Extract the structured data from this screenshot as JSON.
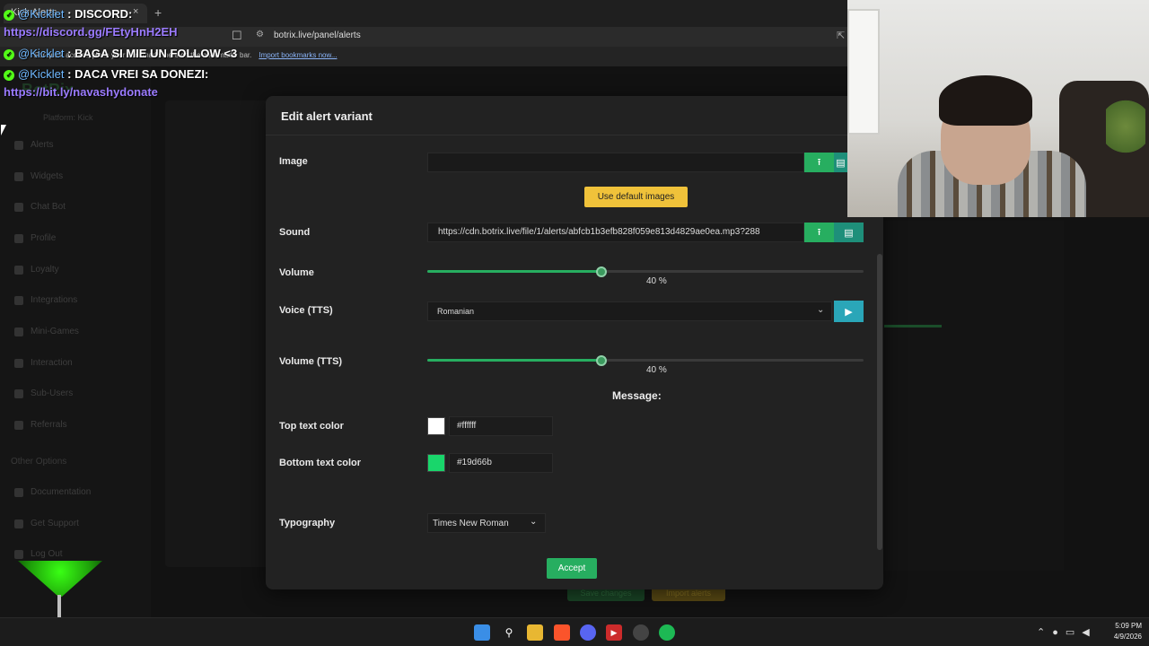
{
  "browser": {
    "tab_title": "Kick Alerts",
    "close_glyph": "×",
    "new_tab_glyph": "+",
    "url": "botrix.live/panel/alerts",
    "bookmark_bar_text": "For quick access, place your bookmarks here on the bookmarks bar.",
    "bookmark_bar_link": "Import bookmarks now..."
  },
  "chat": [
    {
      "user": "@Kicklet",
      "message": ": DISCORD:",
      "link": "https://discord.gg/FEtyHnH2EH"
    },
    {
      "user": "@Kicklet",
      "message": ": BAGA SI MIE UN FOLLOW <3",
      "link": ""
    },
    {
      "user": "@Kicklet",
      "message": ": DACA VREI SA DONEZI:",
      "link": "https://bit.ly/navashydonate"
    }
  ],
  "sidebar": {
    "brand": "BotRix",
    "platform": "Platform: Kick",
    "items": [
      "Alerts",
      "Widgets",
      "Chat Bot",
      "Profile",
      "Loyalty",
      "Integrations",
      "Mini-Games",
      "Interaction",
      "Sub-Users",
      "Referrals"
    ],
    "other_heading": "Other Options",
    "other_items": [
      "Documentation",
      "Get Support",
      "Log Out"
    ]
  },
  "background_buttons": {
    "save": "Save changes",
    "import": "Import alerts"
  },
  "modal": {
    "title": "Edit alert variant",
    "image_label": "Image",
    "image_value": "",
    "default_images_label": "Use default images",
    "sound_label": "Sound",
    "sound_value": "https://cdn.botrix.live/file/1/alerts/abfcb1b3efb828f059e813d4829ae0ea.mp3?288",
    "volume_label": "Volume",
    "volume_value": "40",
    "volume_fraction": 0.4,
    "percent_sign": "%",
    "voice_label": "Voice (TTS)",
    "voice_value": "Romanian",
    "volume_tts_label": "Volume (TTS)",
    "volume_tts_value": "40",
    "volume_tts_fraction": 0.4,
    "message_heading": "Message:",
    "top_color_label": "Top text color",
    "top_color_value": "#ffffff",
    "bottom_color_label": "Bottom text color",
    "bottom_color_value": "#19d66b",
    "typography_label": "Typography",
    "typography_value": "Times New Roman",
    "accept_label": "Accept"
  },
  "icons": {
    "upload": "upload-icon",
    "gallery": "gallery-icon",
    "play": "play-icon",
    "chevron": "chevron-down-icon"
  },
  "colors": {
    "accent_green": "#27ae60",
    "accept_yellow": "#f0c23a",
    "play_teal": "#2aa6b8"
  },
  "taskbar": {
    "time": "5:09 PM",
    "date": "4/9/2026"
  }
}
